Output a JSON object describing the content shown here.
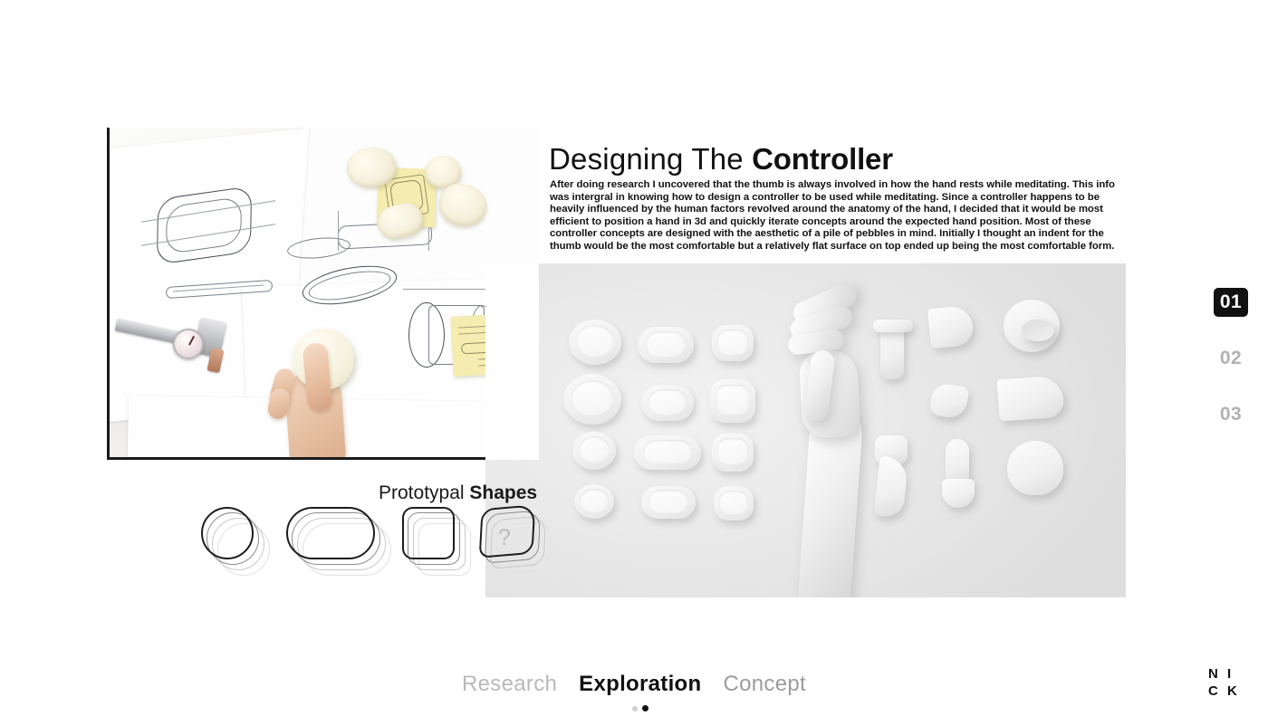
{
  "article": {
    "heading_light": "Designing The",
    "heading_bold": "Controller",
    "body": "After doing research I uncovered that the thumb is always involved in how the hand rests while meditating. This info was intergral in knowing how to design a controller to be used while meditating. Since a controller happens to be heavily influenced by the human factors revolved around the anatomy of the hand, I decided that it would be most efficient to position a hand in 3d and quickly iterate concepts around the expected hand position. Most of these controller concepts are designed with the aesthetic of a pile of pebbles in mind. Initially I thought an indent for the thumb would be the most comfortable but a relatively flat surface on top ended up being the most comfortable form."
  },
  "prototypal": {
    "title_light": "Prototypal",
    "title_bold": "Shapes",
    "shapes": [
      {
        "name": "circle"
      },
      {
        "name": "rounded-rectangle"
      },
      {
        "name": "rounded-square"
      },
      {
        "name": "irregular-quad",
        "label": "?"
      }
    ]
  },
  "media": {
    "photo_alt": "sketchbook-photo-hand-holding-foam-puck-with-calipers",
    "render_alt": "grayscale-3d-render-controller-concept-grid-with-mannequin-hand"
  },
  "pager": {
    "items": [
      {
        "label": "01",
        "active": true
      },
      {
        "label": "02",
        "active": false
      },
      {
        "label": "03",
        "active": false
      }
    ]
  },
  "bottom_nav": {
    "items": [
      {
        "label": "Research",
        "active": false
      },
      {
        "label": "Exploration",
        "active": true
      },
      {
        "label": "Concept",
        "active": false
      }
    ],
    "dots": [
      {
        "active": false
      },
      {
        "active": true
      }
    ]
  },
  "brand": {
    "line1": "N I",
    "line2": "C K"
  },
  "colors": {
    "accent": "#111111",
    "muted": "#b2b2b2",
    "render_bg": "#e6e6e6",
    "sticky": "#f5ecb0"
  }
}
